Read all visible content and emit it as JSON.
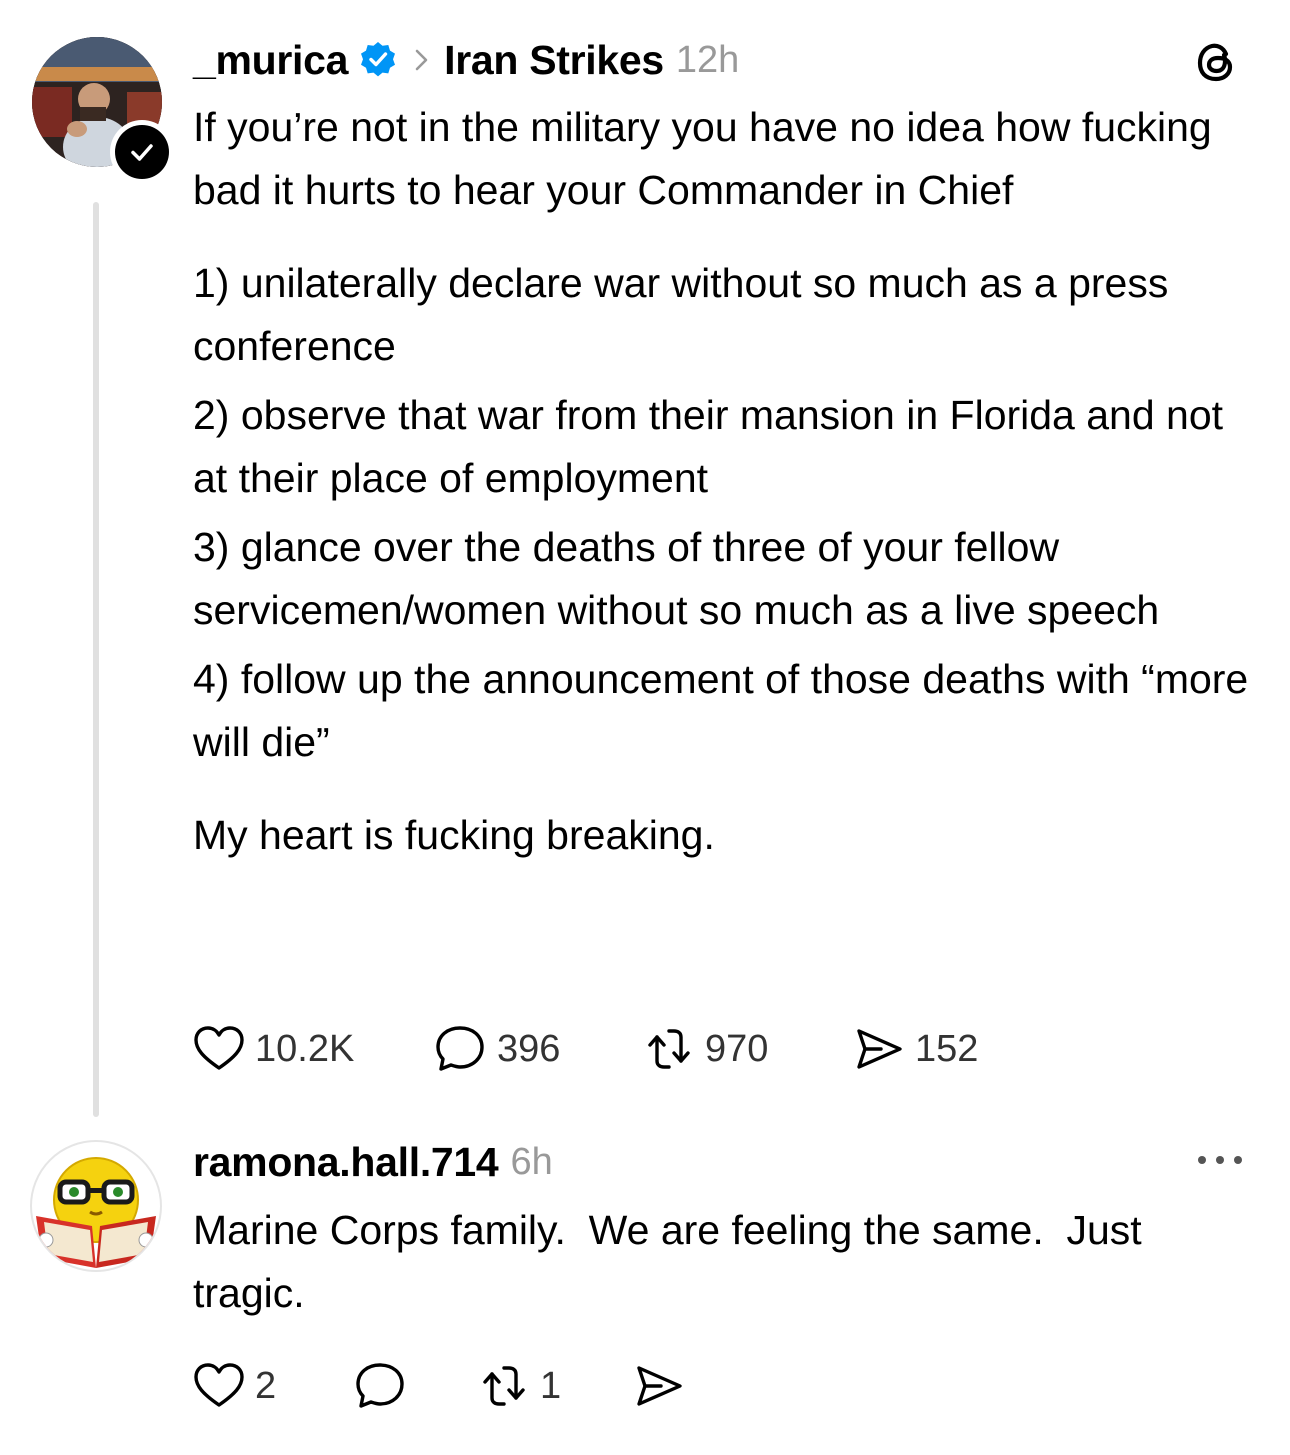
{
  "post": {
    "username": "_murica",
    "topic": "Iran Strikes",
    "time": "12h",
    "paragraphs": [
      "If you’re not in the military you have no idea how fucking bad it hurts to hear your Commander in Chief",
      "1) unilaterally declare war without so much as a press conference",
      "2) observe that war from their mansion in Florida and not at their place of employment",
      "3) glance over the deaths of three of your fellow servicemen/women without so much as a live speech",
      "4) follow up the announcement of those deaths with “more will die”",
      "My heart is fucking breaking."
    ],
    "likes": "10.2K",
    "replies": "396",
    "reposts": "970",
    "shares": "152"
  },
  "reply": {
    "username": "ramona.hall.714",
    "time": "6h",
    "text": "Marine Corps family.  We are feeling the same.  Just tragic.",
    "likes": "2",
    "reposts": "1"
  },
  "colors": {
    "verified_blue": "#0095f6",
    "muted": "#999999",
    "line": "#e0e0e0"
  },
  "icons": [
    "verified-badge-icon",
    "chevron-right-icon",
    "threads-logo-icon",
    "heart-icon",
    "comment-icon",
    "repost-icon",
    "share-icon",
    "more-icon",
    "follow-check-icon"
  ]
}
